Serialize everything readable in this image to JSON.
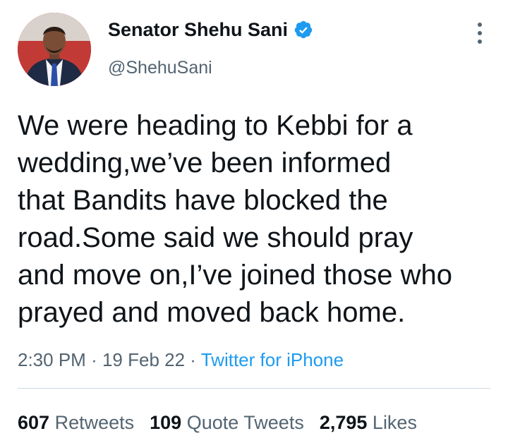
{
  "author": {
    "display_name": "Senator Shehu Sani",
    "handle": "@ShehuSani",
    "verified": true
  },
  "tweet": {
    "text": "We were heading to Kebbi for a\nwedding,we’ve been informed\nthat Bandits have blocked the\nroad.Some said we should pray\nand move on,I’ve joined those who\nprayed and moved back home.",
    "time": "2:30 PM",
    "date": "19 Feb 22",
    "separator": "·",
    "source": "Twitter for iPhone"
  },
  "stats": {
    "retweets_count": "607",
    "retweets_label": "Retweets",
    "quote_tweets_count": "109",
    "quote_tweets_label": "Quote Tweets",
    "likes_count": "2,795",
    "likes_label": "Likes"
  },
  "icons": {
    "verified": "verified-badge-icon",
    "more": "more-options-icon"
  },
  "colors": {
    "text": "#0f1419",
    "secondary": "#536471",
    "link": "#1d9bf0",
    "divider": "#cfd9de"
  }
}
